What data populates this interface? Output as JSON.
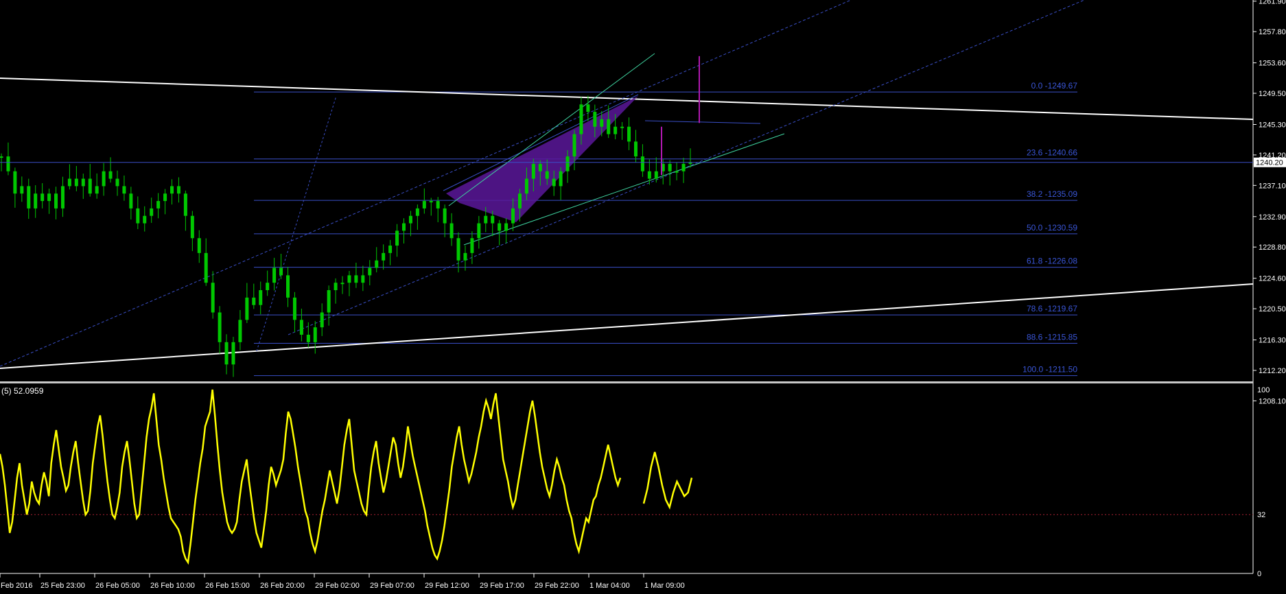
{
  "chart_data": {
    "type": "line",
    "main_panel": {
      "price_axis_ticks": [
        "1261.90",
        "1257.80",
        "1253.60",
        "1249.50",
        "1245.30",
        "1241.20",
        "1237.10",
        "1232.90",
        "1228.80",
        "1224.60",
        "1220.50",
        "1216.30",
        "1212.20",
        "1208.10"
      ],
      "price_range": [
        1206.3,
        1263.0
      ],
      "current_price": "1240.20",
      "fib_levels": [
        {
          "label": "0.0 -1249.67",
          "value": 1249.67
        },
        {
          "label": "23.6 -1240.66",
          "value": 1240.66
        },
        {
          "label": "38.2 -1235.09",
          "value": 1235.09
        },
        {
          "label": "50.0 -1230.59",
          "value": 1230.59
        },
        {
          "label": "61.8 -1226.08",
          "value": 1226.08
        },
        {
          "label": "78.6 -1219.67",
          "value": 1219.67
        },
        {
          "label": "88.6 -1215.85",
          "value": 1215.85
        },
        {
          "label": "100.0 -1211.50",
          "value": 1211.5
        }
      ],
      "price_series": [
        1241,
        1239,
        1236,
        1237,
        1234,
        1236,
        1235,
        1236,
        1234,
        1237,
        1238,
        1237,
        1238,
        1236,
        1237,
        1239,
        1238,
        1237,
        1236,
        1234,
        1232,
        1233,
        1234,
        1235,
        1236,
        1237,
        1236,
        1233,
        1230,
        1228,
        1224,
        1220,
        1216,
        1213,
        1216,
        1219,
        1222,
        1221,
        1223,
        1224,
        1226,
        1225,
        1222,
        1219,
        1217,
        1216,
        1218,
        1220,
        1223,
        1224,
        1224,
        1225,
        1224,
        1225,
        1226,
        1227,
        1228,
        1229,
        1231,
        1232,
        1233,
        1234,
        1235,
        1235,
        1234,
        1232,
        1230,
        1227,
        1228,
        1230,
        1232,
        1233,
        1232,
        1231,
        1232,
        1234,
        1236,
        1238,
        1240,
        1239,
        1238,
        1237,
        1239,
        1241,
        1244,
        1248,
        1247,
        1245,
        1246,
        1244,
        1245,
        1245,
        1243,
        1241,
        1239,
        1238,
        1239,
        1240,
        1239,
        1239,
        1240,
        1240.2
      ],
      "markers": [
        {
          "name": "purple-vertical-1",
          "from": 1254.5,
          "to": 1245.5
        },
        {
          "name": "purple-vertical-2",
          "from": 1245.0,
          "to": 1238.5
        }
      ]
    },
    "indicator_panel": {
      "label": "(5) 52.0959",
      "value": 52.0959,
      "axis_ticks": [
        "100",
        "32",
        "0"
      ],
      "range": [
        0,
        100
      ],
      "level": 32,
      "series": [
        65,
        58,
        48,
        35,
        22,
        28,
        40,
        52,
        60,
        48,
        40,
        32,
        38,
        50,
        44,
        40,
        38,
        48,
        55,
        50,
        42,
        60,
        70,
        78,
        68,
        58,
        52,
        45,
        48,
        58,
        66,
        72,
        60,
        50,
        40,
        32,
        34,
        45,
        60,
        70,
        80,
        86,
        75,
        62,
        50,
        40,
        32,
        30,
        36,
        44,
        58,
        66,
        72,
        62,
        50,
        38,
        30,
        32,
        46,
        60,
        74,
        84,
        90,
        98,
        84,
        70,
        62,
        52,
        44,
        36,
        30,
        28,
        26,
        24,
        20,
        12,
        8,
        6,
        16,
        28,
        40,
        50,
        60,
        68,
        80,
        84,
        88,
        100,
        86,
        70,
        56,
        44,
        36,
        28,
        24,
        22,
        24,
        28,
        40,
        50,
        56,
        62,
        50,
        40,
        30,
        22,
        18,
        14,
        24,
        34,
        48,
        58,
        54,
        48,
        52,
        56,
        62,
        76,
        88,
        84,
        76,
        68,
        58,
        50,
        42,
        34,
        30,
        22,
        16,
        12,
        18,
        26,
        34,
        40,
        48,
        56,
        50,
        44,
        38,
        46,
        58,
        70,
        78,
        84,
        70,
        56,
        50,
        44,
        38,
        34,
        32,
        46,
        58,
        66,
        72,
        60,
        52,
        44,
        50,
        58,
        66,
        74,
        70,
        60,
        52,
        58,
        68,
        80,
        72,
        64,
        58,
        52,
        46,
        40,
        34,
        26,
        20,
        14,
        10,
        8,
        12,
        18,
        26,
        36,
        46,
        58,
        66,
        74,
        80,
        70,
        62,
        56,
        50,
        54,
        60,
        66,
        74,
        80,
        88,
        94,
        90,
        84,
        92,
        98,
        86,
        74,
        62,
        56,
        50,
        42,
        36,
        40,
        48,
        56,
        64,
        72,
        80,
        88,
        94,
        86,
        76,
        66,
        58,
        52,
        46,
        42,
        48,
        56,
        62,
        58,
        52,
        48,
        40,
        34,
        30,
        22,
        16,
        12,
        18,
        24,
        30,
        28,
        34,
        40,
        42,
        48,
        52,
        58,
        64,
        70,
        64,
        58,
        52,
        48,
        52
      ],
      "series_tail": [
        38,
        46,
        58,
        66,
        58,
        48,
        40,
        36,
        44,
        50,
        46,
        42,
        44,
        52
      ]
    },
    "time_axis_ticks": [
      "Feb 2016",
      "25 Feb 23:00",
      "26 Feb 05:00",
      "26 Feb 10:00",
      "26 Feb 15:00",
      "26 Feb 20:00",
      "29 Feb 02:00",
      "29 Feb 07:00",
      "29 Feb 12:00",
      "29 Feb 17:00",
      "29 Feb 22:00",
      "1 Mar 04:00",
      "1 Mar 09:00"
    ],
    "colors": {
      "background": "#000000",
      "candles": "#00c800",
      "fib": "#3a4fc8",
      "fib_text": "#3a56d8",
      "trendline": "#ffffff",
      "channel": "#3a4fc8",
      "wedge_fill": "#5a189a",
      "wedge_edge": "#3fd4a0",
      "marker": "#b018b0",
      "indicator": "#ffff00",
      "level_line": "#aa2233"
    }
  }
}
